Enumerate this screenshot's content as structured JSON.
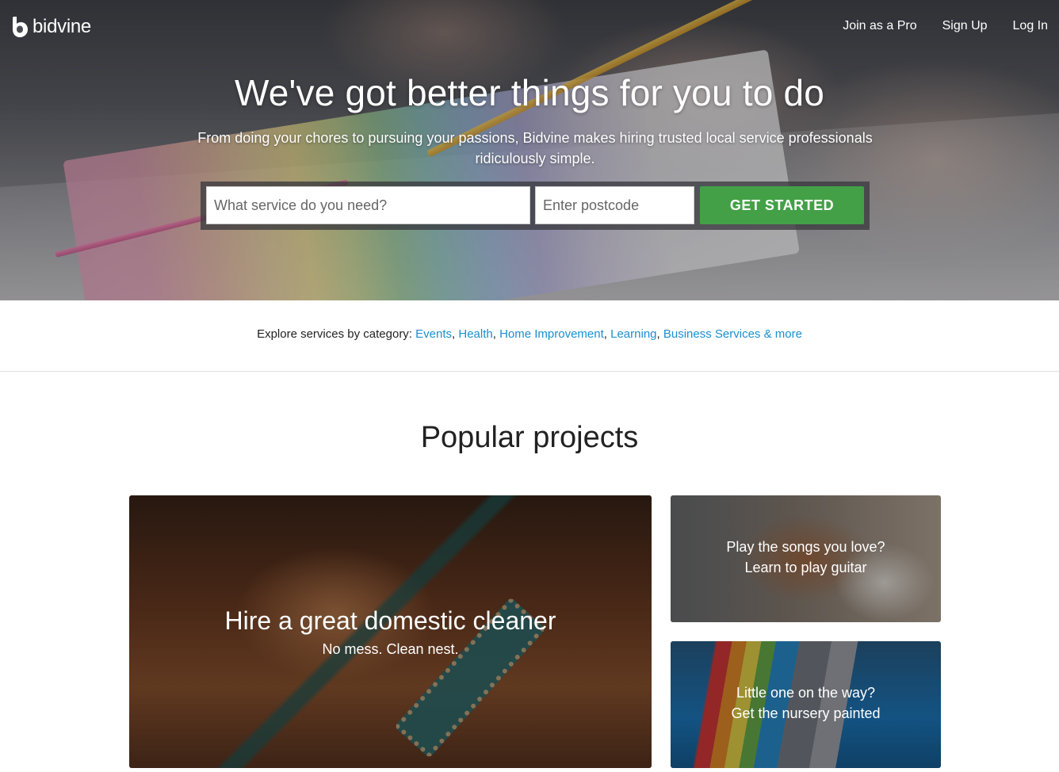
{
  "brand": {
    "name": "bidvine"
  },
  "nav": {
    "join": "Join as a Pro",
    "signup": "Sign Up",
    "login": "Log In"
  },
  "hero": {
    "title": "We've got better things for you to do",
    "subtitle": "From doing your chores to pursuing your passions, Bidvine makes hiring trusted local service professionals ridiculously simple.",
    "service_placeholder": "What service do you need?",
    "postcode_placeholder": "Enter postcode",
    "cta": "GET STARTED"
  },
  "explore": {
    "prefix": "Explore services by category: ",
    "links": [
      "Events",
      "Health",
      "Home Improvement",
      "Learning",
      "Business Services & more"
    ]
  },
  "popular": {
    "title": "Popular projects",
    "cards": [
      {
        "title": "Hire a great domestic cleaner",
        "subtitle": "No mess. Clean nest."
      },
      {
        "title": "Play the songs you love?",
        "subtitle": "Learn to play guitar"
      },
      {
        "title": "Little one on the way?",
        "subtitle": "Get the nursery painted"
      }
    ]
  },
  "colors": {
    "accent_green": "#43a047",
    "link_blue": "#1a8fd0"
  }
}
